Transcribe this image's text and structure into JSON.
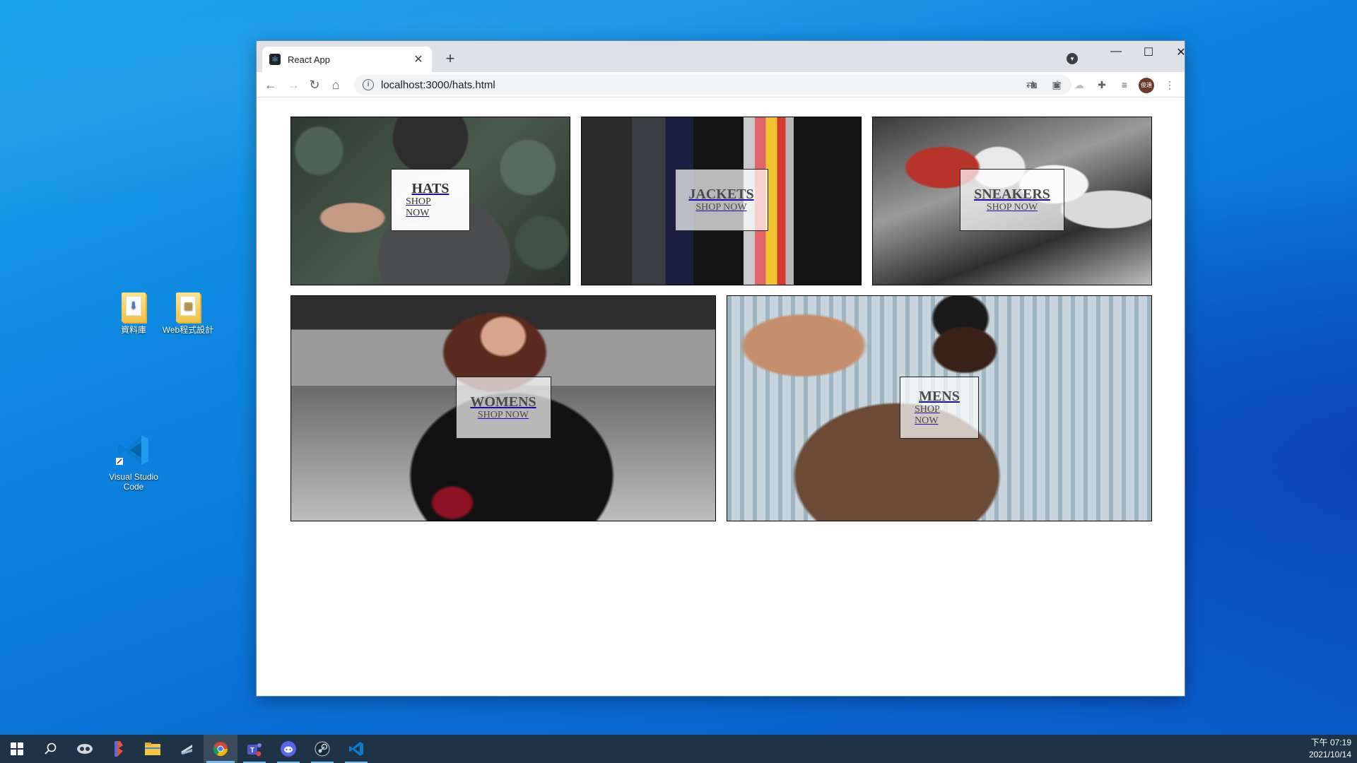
{
  "desktop": {
    "icons": [
      {
        "label": "資料庫"
      },
      {
        "label": "Web程式設計"
      },
      {
        "label": "Visual Studio Code"
      }
    ]
  },
  "browser": {
    "tab_title": "React App",
    "url": "localhost:3000/hats.html",
    "new_tab_symbol": "+",
    "profile_initials": "俊達"
  },
  "directory": {
    "items": [
      {
        "title": "HATS",
        "subtitle": "SHOP NOW"
      },
      {
        "title": "JACKETS",
        "subtitle": "SHOP NOW"
      },
      {
        "title": "SNEAKERS",
        "subtitle": "SHOP NOW"
      },
      {
        "title": "WOMENS",
        "subtitle": "SHOP NOW"
      },
      {
        "title": "MENS",
        "subtitle": "SHOP NOW"
      }
    ]
  },
  "taskbar": {
    "time": "下午 07:19",
    "date": "2021/10/14",
    "apps": [
      "start-icon",
      "search-icon",
      "mixed-reality-icon",
      "powertoys-icon",
      "file-explorer-icon",
      "ms-store-icon",
      "chrome-icon",
      "teams-icon",
      "discord-icon",
      "steam-icon",
      "vscode-icon"
    ]
  },
  "colors": {
    "taskbar_bg": "#1f3347",
    "desktop_blue": "#0a78d7",
    "link_underline": "#1a0dab"
  }
}
